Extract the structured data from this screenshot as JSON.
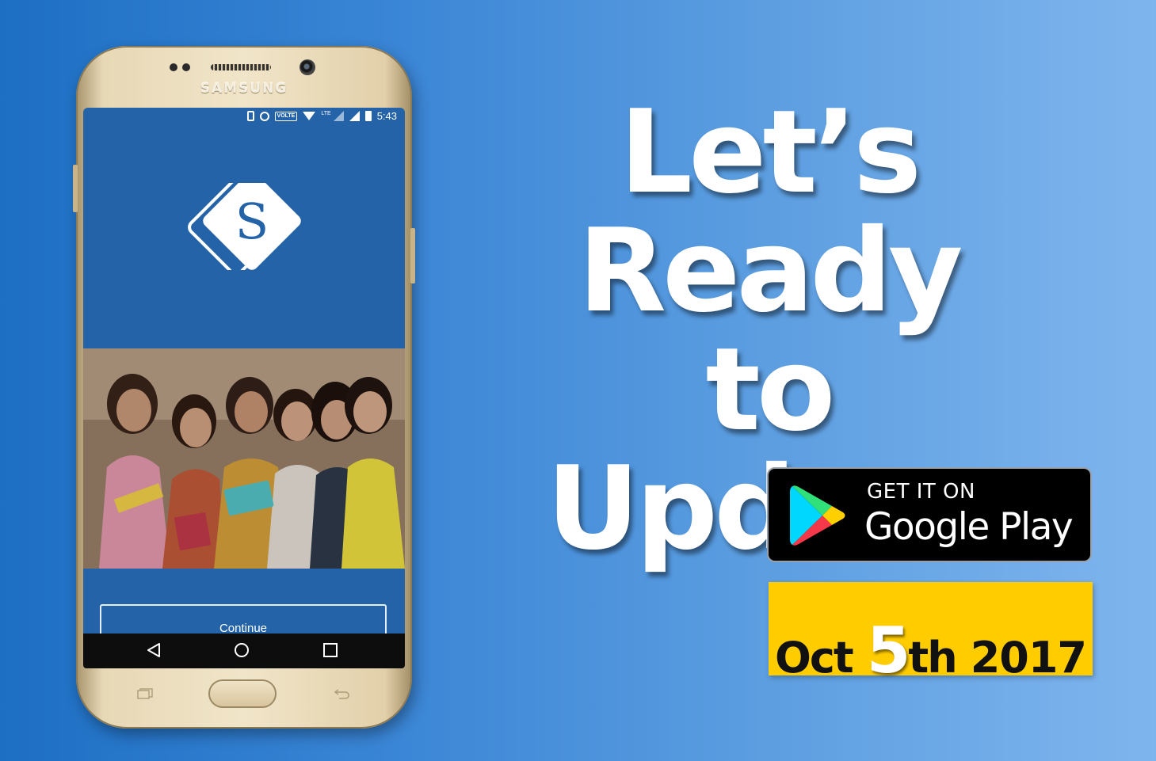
{
  "phone": {
    "brand": "SAMSUNG",
    "status_bar": {
      "volte": "VOLTE",
      "lte": "LTE",
      "time": "5:43"
    },
    "app": {
      "logo_letter": "S",
      "continue_label": "Continue"
    },
    "nav_icons": [
      "back-icon",
      "home-icon",
      "recents-icon"
    ]
  },
  "headline": {
    "line1": "Let’s Ready",
    "line2": "to",
    "line3": "Update"
  },
  "google_play": {
    "small_text": "GET IT ON",
    "big_text": "Google Play"
  },
  "date": {
    "month": "Oct",
    "day": "5",
    "suffix": "th",
    "year": "2017"
  },
  "colors": {
    "accent_yellow": "#ffcc00",
    "app_blue": "#2463a8"
  }
}
